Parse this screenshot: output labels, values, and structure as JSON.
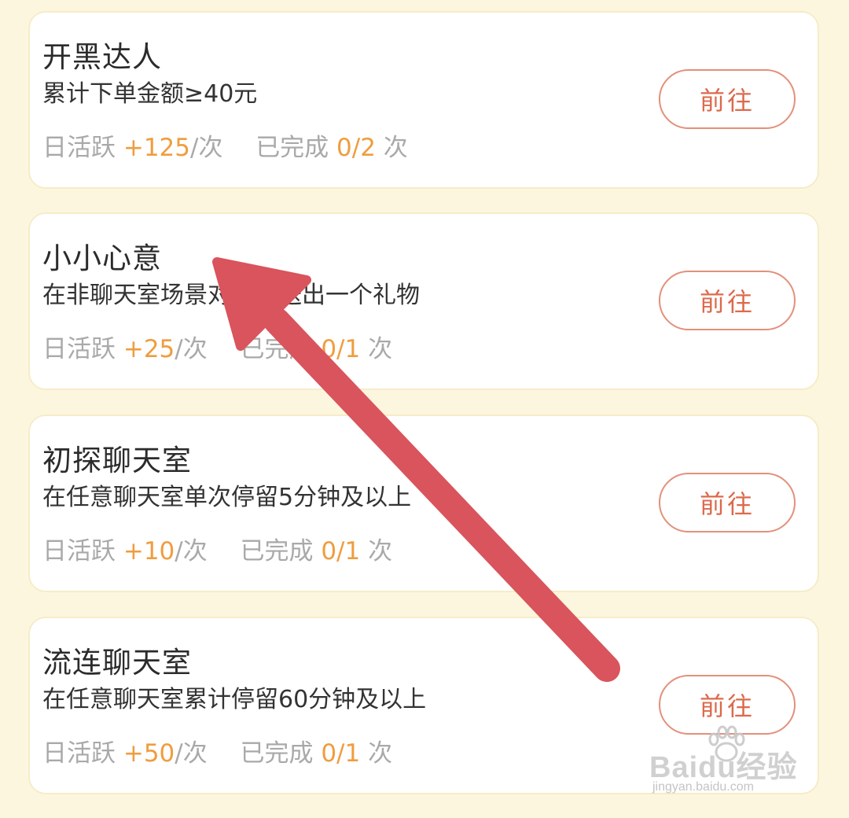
{
  "tasks": [
    {
      "title": "开黑达人",
      "desc": "累计下单金额≥40元",
      "activity_label": "日活跃",
      "reward": "+125",
      "per": "/次",
      "done_label": "已完成",
      "progress": "0/2",
      "times": "次",
      "button": "前往"
    },
    {
      "title": "小小心意",
      "desc": "在非聊天室场景对他人送出一个礼物",
      "activity_label": "日活跃",
      "reward": "+25",
      "per": "/次",
      "done_label": "已完成",
      "progress": "0/1",
      "times": "次",
      "button": "前往"
    },
    {
      "title": "初探聊天室",
      "desc": "在任意聊天室单次停留5分钟及以上",
      "activity_label": "日活跃",
      "reward": "+10",
      "per": "/次",
      "done_label": "已完成",
      "progress": "0/1",
      "times": "次",
      "button": "前往"
    },
    {
      "title": "流连聊天室",
      "desc": "在任意聊天室累计停留60分钟及以上",
      "activity_label": "日活跃",
      "reward": "+50",
      "per": "/次",
      "done_label": "已完成",
      "progress": "0/1",
      "times": "次",
      "button": "前往"
    }
  ],
  "watermark": {
    "logo": "Baidu经验",
    "url": "jingyan.baidu.com"
  },
  "colors": {
    "background": "#fdf6df",
    "accent": "#ef9d3f",
    "button_text": "#dc6a4c",
    "arrow": "#d9545c"
  }
}
